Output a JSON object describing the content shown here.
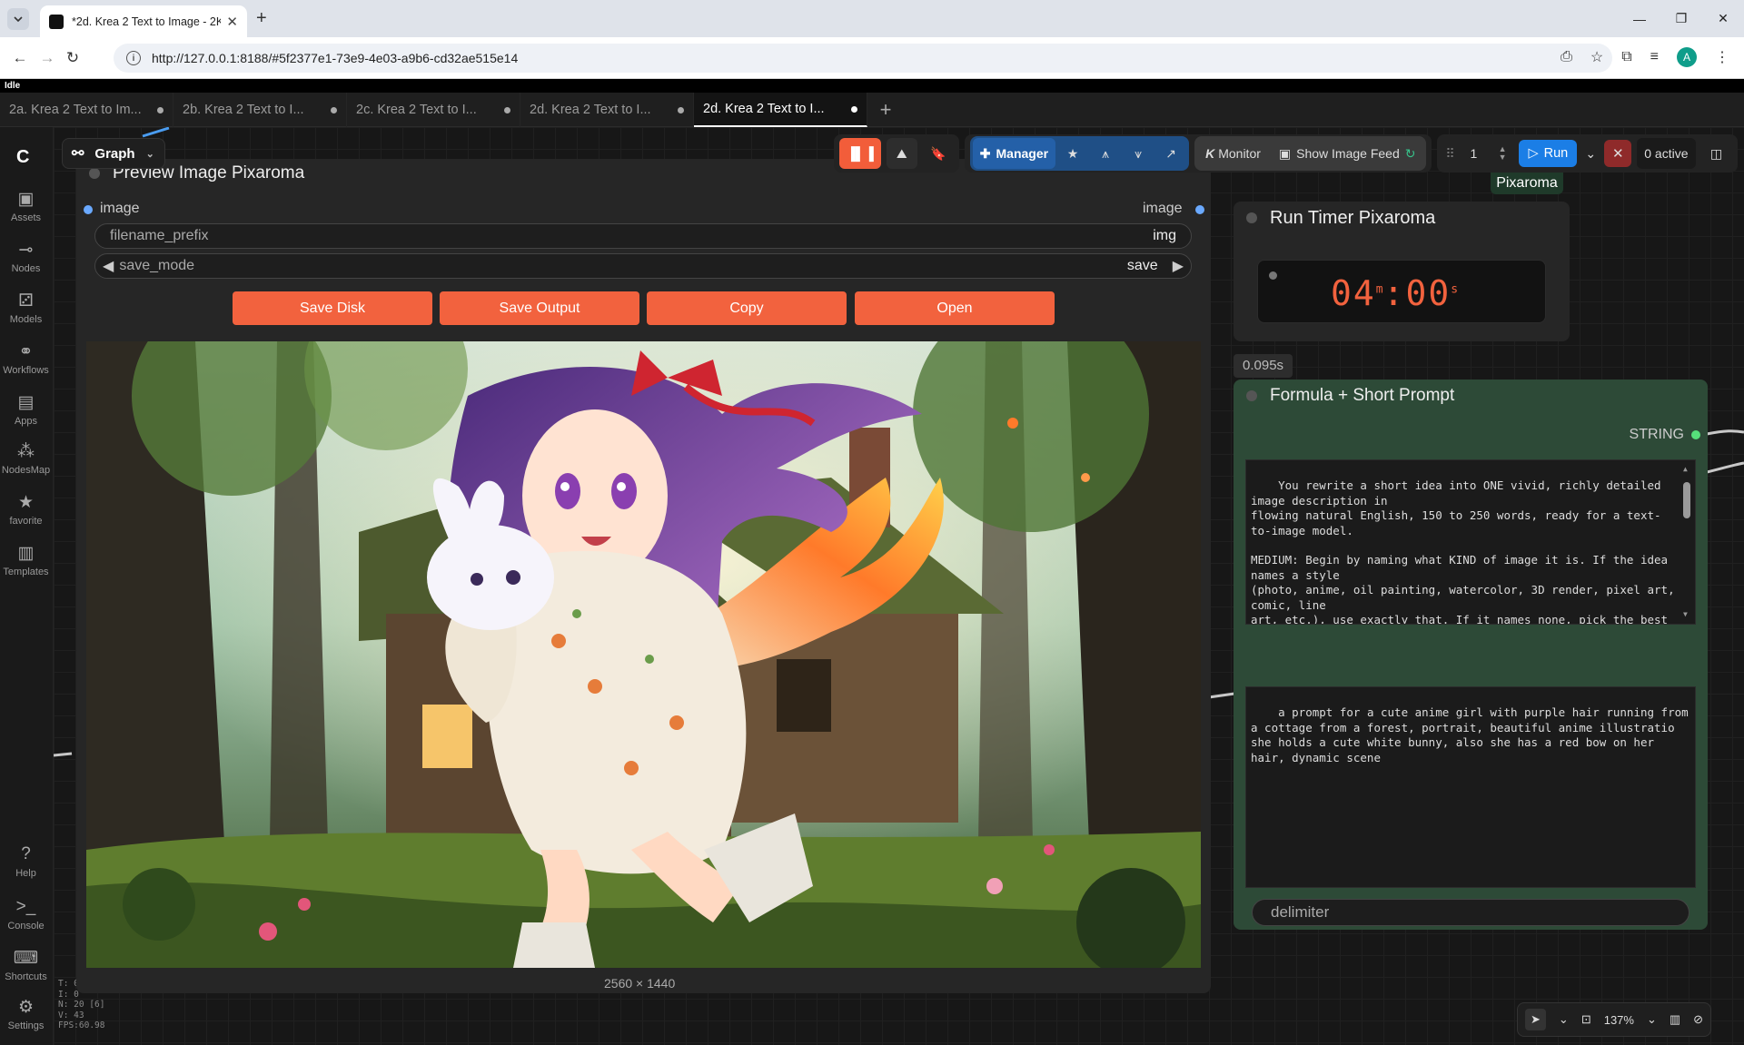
{
  "browser": {
    "tab_title": "*2d. Krea 2 Text to Image - 2K",
    "url": "http://127.0.0.1:8188/#5f2377e1-73e9-4e03-a9b6-cd32ae515e14",
    "avatar_letter": "A"
  },
  "status": "Idle",
  "workflow_tabs": [
    {
      "label": "2a. Krea 2 Text to Im...",
      "active": false
    },
    {
      "label": "2b. Krea 2 Text to I...",
      "active": false
    },
    {
      "label": "2c. Krea 2 Text to I...",
      "active": false
    },
    {
      "label": "2d. Krea 2 Text to I...",
      "active": false
    },
    {
      "label": "2d. Krea 2 Text to I...",
      "active": true
    }
  ],
  "sidebar": {
    "items": [
      {
        "label": "Assets",
        "icon": "image-icon"
      },
      {
        "label": "Nodes",
        "icon": "nodes-icon"
      },
      {
        "label": "Models",
        "icon": "models-icon"
      },
      {
        "label": "Workflows",
        "icon": "workflows-icon"
      },
      {
        "label": "Apps",
        "icon": "apps-icon"
      },
      {
        "label": "NodesMap",
        "icon": "nodesmap-icon"
      },
      {
        "label": "favorite",
        "icon": "star-icon"
      },
      {
        "label": "Templates",
        "icon": "templates-icon"
      }
    ],
    "bottom": [
      {
        "label": "Help",
        "icon": "help-icon"
      },
      {
        "label": "Console",
        "icon": "console-icon"
      },
      {
        "label": "Shortcuts",
        "icon": "keyboard-icon"
      },
      {
        "label": "Settings",
        "icon": "gear-icon"
      }
    ]
  },
  "stats": [
    "T: 0",
    "I: 0",
    "N: 20 [6]",
    "V: 43",
    "FPS:60.98"
  ],
  "graph_label": "Graph",
  "toolbar": {
    "manager_label": "Manager",
    "monitor_label": "Monitor",
    "image_feed_label": "Show Image Feed",
    "queue_count": "1",
    "run_label": "Run",
    "active_label": "0 active",
    "pixaroma_label": "Pixaroma"
  },
  "preview_node": {
    "title": "Preview Image Pixaroma",
    "input_label": "image",
    "output_label": "image",
    "filename_prefix_label": "filename_prefix",
    "filename_prefix_value": "img",
    "save_mode_label": "save_mode",
    "save_mode_value": "save",
    "buttons": [
      "Save Disk",
      "Save Output",
      "Copy",
      "Open"
    ],
    "image_size": "2560 × 1440"
  },
  "timer_node": {
    "title": "Run Timer Pixaroma",
    "minutes": "04",
    "seconds": "00",
    "min_unit": "m",
    "sec_unit": "s"
  },
  "execution_time": "0.095s",
  "formula_node": {
    "title": "Formula + Short Prompt",
    "output_label": "STRING",
    "system_text": "You rewrite a short idea into ONE vivid, richly detailed image description in\nflowing natural English, 150 to 250 words, ready for a text-to-image model.\n\nMEDIUM: Begin by naming what KIND of image it is. If the idea names a style\n(photo, anime, oil painting, watercolor, 3D render, pixel art, comic, line\nart, etc.), use exactly that. If it names none, pick the best fit: for real\npeople, places, objects, or any true-to-life scene, make it a realistic\nphotograph; for characters, creatures, or stylized subjects, choose the\nfitting art style.",
    "prompt_text": "a prompt for a cute anime girl with purple hair running from a cottage from a forest, portrait, beautiful anime illustratio she holds a cute white bunny, also she has a red bow on her hair, dynamic scene",
    "delimiter_label": "delimiter"
  },
  "zoom": "137%",
  "colors": {
    "accent": "#f2623e",
    "run_blue": "#1b7ee6",
    "node_green": "#2d4a37"
  }
}
